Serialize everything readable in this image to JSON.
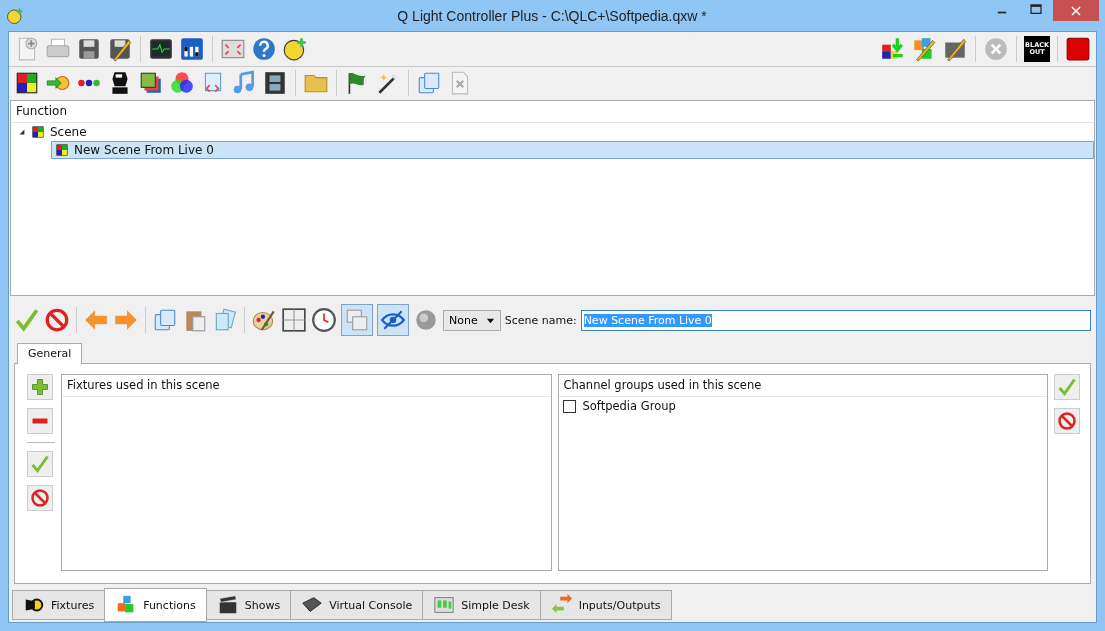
{
  "window": {
    "title": "Q Light Controller Plus - C:\\QLC+\\Softpedia.qxw *"
  },
  "main_toolbar": {
    "blackout_lines": [
      "BLACK",
      "OUT"
    ]
  },
  "tree": {
    "column": "Function",
    "items": [
      {
        "label": "Scene",
        "expanded": true,
        "selected": false,
        "children": [
          {
            "label": "New Scene From Live 0",
            "selected": true
          }
        ]
      }
    ]
  },
  "scene_toolbar": {
    "toggles": [
      {
        "kind": "tile",
        "on": true
      },
      {
        "kind": "blind",
        "on": true
      }
    ],
    "fade_select": "None",
    "name_label": "Scene name:",
    "name_value": "New Scene From Live 0"
  },
  "editor_tabs": [
    {
      "label": "General",
      "selected": true
    }
  ],
  "fixtures_panel": {
    "title": "Fixtures used in this scene"
  },
  "groups_panel": {
    "title": "Channel groups used in this scene",
    "items": [
      {
        "label": "Softpedia Group",
        "checked": false
      }
    ]
  },
  "bottom_tabs": [
    {
      "kind": "fixtures",
      "label": "Fixtures",
      "selected": false
    },
    {
      "kind": "functions",
      "label": "Functions",
      "selected": true
    },
    {
      "kind": "shows",
      "label": "Shows",
      "selected": false
    },
    {
      "kind": "console",
      "label": "Virtual Console",
      "selected": false
    },
    {
      "kind": "desk",
      "label": "Simple Desk",
      "selected": false
    },
    {
      "kind": "io",
      "label": "Inputs/Outputs",
      "selected": false
    }
  ]
}
